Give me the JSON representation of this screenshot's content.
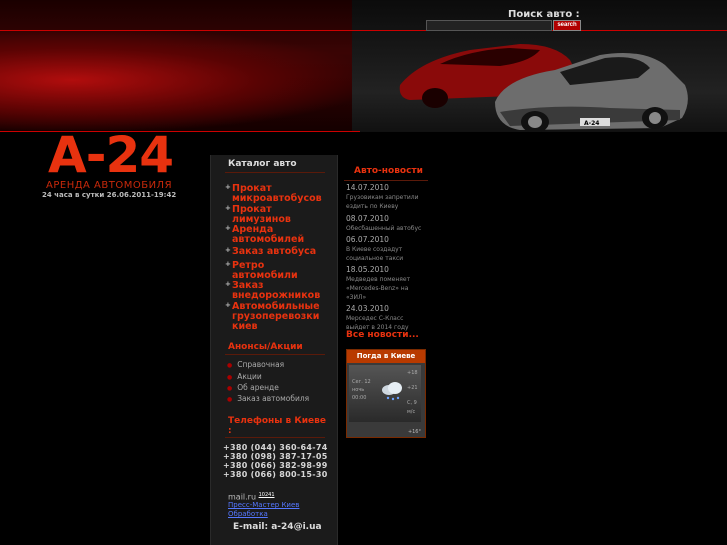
{
  "search": {
    "label": "Поиск авто :",
    "placeholder": "",
    "button": "search"
  },
  "logo": {
    "name": "A-24",
    "slogan": "АРЕНДА АВТОМОБИЛЯ",
    "hours": "24 часа в сутки 26.06.2011-19:42"
  },
  "catalog": {
    "title": "Каталог авто",
    "items": [
      "Прокат микроавтобусов",
      "Прокат лимузинов",
      "Аренда автомобилей",
      "Заказ автобуса",
      "Ретро автомобили",
      "Заказ внедорожников",
      "Автомобильные грузоперевозки киев"
    ]
  },
  "anons": {
    "title": "Анонсы/Акции",
    "items": [
      "Справочная",
      "Акции",
      "Об аренде",
      "Заказ автомобиля"
    ]
  },
  "phones": {
    "title": "Телефоны в Киеве :",
    "items": [
      "+380 (044) 360-64-74",
      "+380 (098) 387-17-05",
      "+380 (066) 382-98-99",
      "+380 (066) 800-15-30"
    ]
  },
  "footer_info": {
    "mailru": "mail.ru",
    "mailru_count": "10241",
    "mail_link_line1": "Пресс-Мастер Киев",
    "mail_link_line2": "Обработка",
    "email": "E-mail: a-24@i.ua"
  },
  "news": {
    "title": "Авто-новости",
    "items": [
      {
        "date": "14.07.2010",
        "text": "Грузовикам запретили ездить по Киеву"
      },
      {
        "date": "08.07.2010",
        "text": "Обесбашенный автобус"
      },
      {
        "date": "06.07.2010",
        "text": "В Киеве создадут социальное такси"
      },
      {
        "date": "18.05.2010",
        "text": "Медведев поменяет «Mercedes-Benz» на «ЗИЛ»"
      },
      {
        "date": "24.03.2010",
        "text": "Мерседес С-Класс выйдет в 2014 году"
      }
    ],
    "all_news": "Все новости..."
  },
  "weather": {
    "title": "Погда в Киеве",
    "today_label": "Сег. 12",
    "sub1": "ночь",
    "sub2": "00:00",
    "t1": "+18",
    "t2": "+21",
    "wind": "С, 9",
    "wind_unit": "м/с",
    "footer": "+16°"
  },
  "colors": {
    "accent": "#e8320f",
    "background": "#000000",
    "column": "#1b1b1b",
    "weather_header": "#b83a00"
  }
}
